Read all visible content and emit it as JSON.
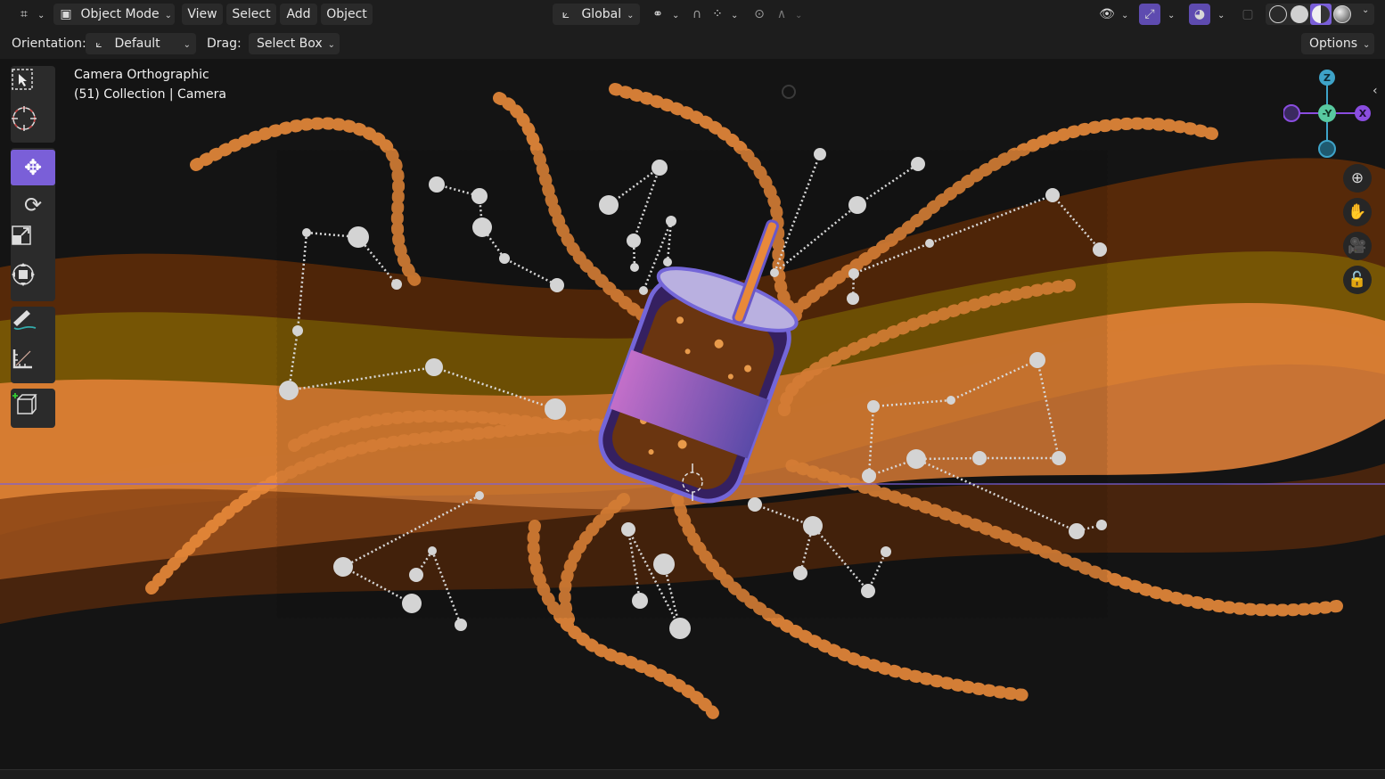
{
  "header": {
    "editor_type_icon": "editor-type-icon",
    "mode_label": "Object Mode",
    "menus": [
      "View",
      "Select",
      "Add",
      "Object"
    ],
    "transform_orientation": "Global",
    "icons": [
      "link-icon",
      "snap-magnet-icon",
      "snap-increment-icon",
      "proportional-edit-icon",
      "falloff-curve-icon",
      "visibility-eye-icon",
      "gizmo-icon",
      "overlays-icon",
      "xray-icon",
      "wireframe-shading-icon",
      "solid-shading-icon",
      "material-shading-icon",
      "rendered-shading-icon"
    ]
  },
  "tool_header": {
    "orientation_label": "Orientation:",
    "orientation_value": "Default",
    "drag_label": "Drag:",
    "drag_value": "Select Box",
    "options_label": "Options"
  },
  "viewport": {
    "view_name": "Camera Orthographic",
    "collection_info": "(51) Collection | Camera",
    "accent_color": "#7a5fd8"
  },
  "toolbar": {
    "tools": [
      "select-box-tool",
      "cursor-tool",
      "move-tool",
      "rotate-tool",
      "scale-tool",
      "transform-tool",
      "annotate-tool",
      "measure-tool",
      "add-cube-tool"
    ],
    "active_tool": "move-tool"
  },
  "nav_gizmo": {
    "z": "Z",
    "y": "-Y",
    "x": "X"
  },
  "nav_buttons": [
    "zoom-icon",
    "pan-hand-icon",
    "camera-view-icon",
    "lock-icon"
  ],
  "colors": {
    "header_bg": "#1d1d1d",
    "active_tool": "#7a5fd8",
    "orange": "#e8893a",
    "dark_orange": "#5a2a08"
  }
}
